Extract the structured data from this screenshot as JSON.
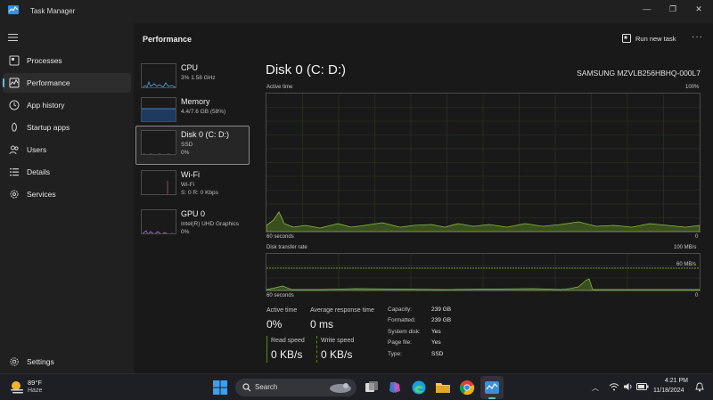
{
  "window": {
    "title": "Task Manager",
    "icon": "task-manager-icon",
    "controls": {
      "minimize": "—",
      "maximize": "❐",
      "close": "✕"
    }
  },
  "sidebar": {
    "items": [
      {
        "label": "Processes",
        "icon": "processes-icon"
      },
      {
        "label": "Performance",
        "icon": "performance-icon",
        "active": true
      },
      {
        "label": "App history",
        "icon": "history-icon"
      },
      {
        "label": "Startup apps",
        "icon": "startup-icon"
      },
      {
        "label": "Users",
        "icon": "users-icon"
      },
      {
        "label": "Details",
        "icon": "details-icon"
      },
      {
        "label": "Services",
        "icon": "services-icon"
      }
    ],
    "settings_label": "Settings"
  },
  "header": {
    "title": "Performance",
    "run_new_task": "Run new task",
    "more": "···"
  },
  "resources": [
    {
      "name": "CPU",
      "sub1": "3%  1.58 GHz",
      "sub2": ""
    },
    {
      "name": "Memory",
      "sub1": "4.4/7.6 GB (58%)",
      "sub2": ""
    },
    {
      "name": "Disk 0 (C: D:)",
      "sub1": "SSD",
      "sub2": "0%",
      "selected": true
    },
    {
      "name": "Wi-Fi",
      "sub1": "Wi-Fi",
      "sub2": "S: 0  R: 0 Kbps"
    },
    {
      "name": "GPU 0",
      "sub1": "Intel(R) UHD Graphics",
      "sub2": "0%"
    }
  ],
  "detail": {
    "title": "Disk 0 (C: D:)",
    "model": "SAMSUNG MZVLB256HBHQ-000L7",
    "active_time_graph": {
      "label": "Active time",
      "max": "100%",
      "time_span": "60 seconds",
      "min": "0"
    },
    "transfer_graph": {
      "label": "Disk transfer rate",
      "max": "100 MB/s",
      "line": "60 MB/s",
      "time_span": "60 seconds",
      "min": "0"
    },
    "stats": {
      "active_time_label": "Active time",
      "active_time_value": "0%",
      "avg_response_label": "Average response time",
      "avg_response_value": "0 ms",
      "read_speed_label": "Read speed",
      "read_speed_value": "0 KB/s",
      "write_speed_label": "Write speed",
      "write_speed_value": "0 KB/s"
    },
    "properties": [
      {
        "key": "Capacity:",
        "value": "239 GB"
      },
      {
        "key": "Formatted:",
        "value": "239 GB"
      },
      {
        "key": "System disk:",
        "value": "Yes"
      },
      {
        "key": "Page file:",
        "value": "Yes"
      },
      {
        "key": "Type:",
        "value": "SSD"
      }
    ]
  },
  "taskbar": {
    "weather_temp": "89°F",
    "weather_desc": "Haze",
    "search_placeholder": "Search",
    "time": "4:21 PM",
    "date": "11/18/2024"
  },
  "colors": {
    "disk_accent": "#8bbf3a",
    "accent": "#4cc2ff",
    "cpu": "#4ea3e0",
    "wifi": "#c86fb0",
    "gpu": "#b56ad6"
  }
}
